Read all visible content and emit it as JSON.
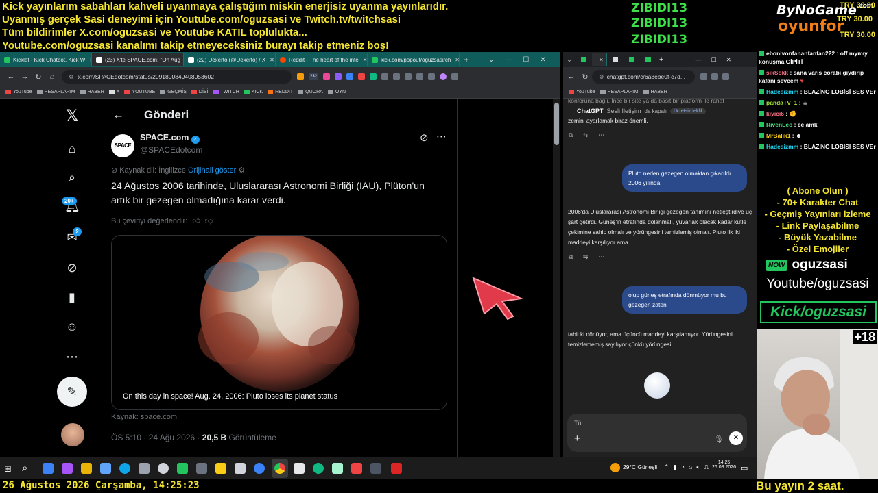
{
  "overlay": {
    "ticker_lines": [
      "Kick yayınlarım sabahları kahveli uyanmaya çalıştığım miskin enerjisiz uyanma yayınlarıdır.",
      "Uyanmış gerçek Sasi deneyimi için Youtube.com/oguzsasi ve Twitch.tv/twitchsasi",
      "Tüm bildirimler X.com/oguzsasi ve Youtube KATIL toplulukta...",
      "Youtube.com/oguzsasi kanalımı takip etmeyeceksiniz burayı takip etmeniz boş!"
    ],
    "donors": [
      "ZIBIDI13",
      "ZIBIDI13",
      "ZIBIDI13"
    ],
    "logo_top": "ByNoGame",
    "logo_com": ".com",
    "logo_bottom": "oyunfor",
    "prices": [
      "TRY 30.00",
      "TRY 30.00",
      "TRY 30.00"
    ]
  },
  "browser_left": {
    "tabs": [
      {
        "label": "Kicklet - Kick Chatbot, Kick W",
        "color": "#22c55e"
      },
      {
        "label": "(23) X'te SPACE.com: \"On Aug",
        "color": "#ffffff"
      },
      {
        "label": "(22) Dexerto (@Dexerto) / X",
        "color": "#ffffff"
      },
      {
        "label": "Reddit - The heart of the inte",
        "color": "#ff4500"
      },
      {
        "label": "kick.com/popout/oguzsasi/ch",
        "color": "#22c55e"
      }
    ],
    "new_tab": "+",
    "window_controls": [
      "⌄",
      "—",
      "☐",
      "✕"
    ],
    "url": "x.com/SPACEdotcom/status/2091890849408053602",
    "badge_count": "232",
    "bookmarks": [
      "YouTube",
      "HESAPLARIM",
      "HABER",
      "X",
      "YOUTUBE",
      "GEÇMİŞ",
      "DİSİ",
      "TWITCH",
      "KICK",
      "REDDIT",
      "QUORA",
      "OYN"
    ]
  },
  "x_post": {
    "header_title": "Gönderi",
    "author_name": "SPACE.com",
    "author_handle": "@SPACEdotcom",
    "avatar_text": "SPACE",
    "translated_from": "Kaynak dil: İngilizce",
    "show_original": "Orijinali göster",
    "text": "24 Ağustos 2006 tarihinde, Uluslararası Astronomi Birliği (IAU), Plüton'un artık bir gezegen olmadığına karar verdi.",
    "rate_translation": "Bu çeviriyi değerlendir:",
    "card_caption": "On this day in space! Aug. 24, 2006: Pluto loses its planet status",
    "source": "Kaynak: space.com",
    "time": "ÖS 5:10 · 24 Ağu 2026 · ",
    "views_count": "20,5 B",
    "views_label": " Görüntüleme",
    "notif_badge": "20+",
    "msg_badge": "2"
  },
  "browser_right": {
    "url": "chatgpt.com/c/6a8ebe0f-c7d...",
    "bookmarks": [
      "YouTube",
      "HESAPLARIM",
      "HABER"
    ]
  },
  "chatgpt": {
    "top_partial": "konforuna bağlı. İnce bir site ya da basit bir platform ile rahat",
    "voice_title": "ChatGPT",
    "voice_sub": "Sesli İletişim",
    "voice_partial": "da kapalı",
    "free_badge": "Ücretsiz teklif",
    "top_partial2": "zemini ayarlamak biraz önemli.",
    "user_msg1": "Pluto neden gezegen olmaktan çıkarıldı 2006 yılında",
    "ai_msg1": "2006'da Uluslararası Astronomi Birliği gezegen tanımını netleştirdive üç şart getirdi. Güneş'in etrafında dolanmalı, yuvarlak olacak kadar kütle çekimine sahip olmalı ve yörüngesini temizlemiş olmalı. Pluto ilk iki maddeyi karşılıyor ama",
    "user_msg2": "olup güneş etrafında dönmüyor mu bu gezegen zaten",
    "ai_msg2": "tabii ki dönüyor, ama üçüncü maddeyi karşılamıyor. Yörüngesini temizlememiş sayılıyor çünkü yörüngesi",
    "input_placeholder": "Tür",
    "plus": "+"
  },
  "stream_chat": {
    "messages": [
      {
        "user": "ebonivonfananfanfan222",
        "user_color": "#ffffff",
        "text": " : off mymıy konuşma GİPİTİ"
      },
      {
        "user": "sikSokk",
        "user_color": "#ff6b81",
        "text": " : sana varis corabi giydirip kafani sevcem"
      },
      {
        "user": "Hadesizmm",
        "user_color": "#22d3ee",
        "text": " : BLAZİNG LOBİSİ SES VEr"
      },
      {
        "user": "pandaTV_1",
        "user_color": "#a3e635",
        "text": " :"
      },
      {
        "user": "kiyici6",
        "user_color": "#fb7185",
        "text": " :"
      },
      {
        "user": "RivenLeo",
        "user_color": "#4ade80",
        "text": " : ee amk"
      },
      {
        "user": "MrBalik1",
        "user_color": "#facc15",
        "text": " :"
      },
      {
        "user": "Hadesizmm",
        "user_color": "#22d3ee",
        "text": " : BLAZİNG LOBİSİ SES VEr"
      }
    ],
    "perks": [
      "( Abone Olun )",
      "- 70+ Karakter Chat",
      "- Geçmiş Yayınları İzleme",
      "- Link Paylaşabilme",
      "- Büyük Yazabilme",
      "- Özel Emojiler"
    ],
    "now_badge": "NOW",
    "now_name": "oguzsasi",
    "youtube_link": "Youtube/oguzsasi",
    "kick_link": "Kick/oguzsasi",
    "age_badge": "+18"
  },
  "taskbar": {
    "weather": "29°C  Güneşli",
    "time": "14:25",
    "date": "26.08.2026"
  },
  "bottom": {
    "datetime": "26 Ağustos 2026 Çarşamba, 14:25:23",
    "right_text": "Bu yayın 2 saat."
  }
}
